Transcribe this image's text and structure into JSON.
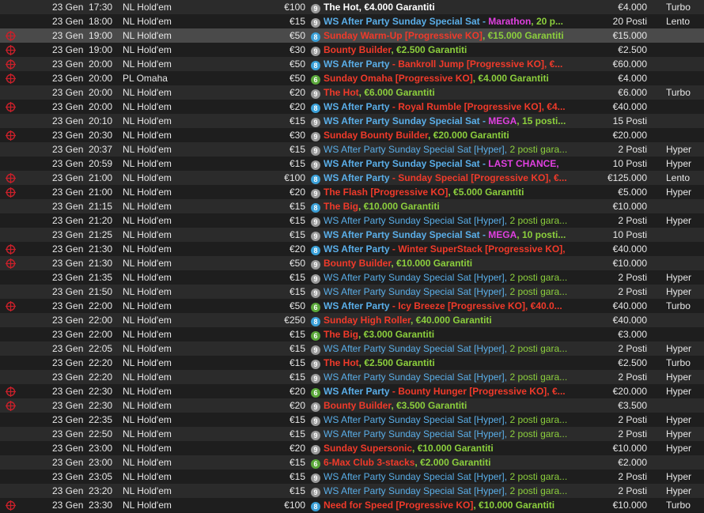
{
  "colors": {
    "white": "#ffffff",
    "red": "#f03a2a",
    "green": "#8ccf3d",
    "blue": "#5aaee8",
    "magenta": "#e040e0",
    "badge_gray": "#9a9a9a",
    "badge_blue": "#3aa0d8",
    "badge_green": "#5aa83a",
    "pk_icon": "#c8202a"
  },
  "rows": [
    {
      "pk": false,
      "date": "23 Gen",
      "time": "17:30",
      "game": "NL Hold'em",
      "buyin": "€100",
      "badge": "9",
      "badge_color": "badge_gray",
      "name": [
        {
          "t": "The Hot, €4.000 Garantiti",
          "c": "white"
        }
      ],
      "prize": "€4.000",
      "speed": "Turbo"
    },
    {
      "pk": false,
      "date": "23 Gen",
      "time": "18:00",
      "game": "NL Hold'em",
      "buyin": "€15",
      "badge": "9",
      "badge_color": "badge_gray",
      "name": [
        {
          "t": "WS After Party Sunday Special Sat - ",
          "c": "blue"
        },
        {
          "t": "Marathon",
          "c": "magenta"
        },
        {
          "t": ", 20 p...",
          "c": "green"
        }
      ],
      "prize": "20 Posti",
      "speed": "Lento"
    },
    {
      "pk": true,
      "sel": true,
      "date": "23 Gen",
      "time": "19:00",
      "game": "NL Hold'em",
      "buyin": "€50",
      "badge": "8",
      "badge_color": "badge_blue",
      "name": [
        {
          "t": "Sunday Warm-Up [Progressive KO]",
          "c": "red"
        },
        {
          "t": ", €15.000 Garantiti",
          "c": "green"
        }
      ],
      "prize": "€15.000",
      "speed": ""
    },
    {
      "pk": true,
      "date": "23 Gen",
      "time": "19:00",
      "game": "NL Hold'em",
      "buyin": "€30",
      "badge": "9",
      "badge_color": "badge_gray",
      "name": [
        {
          "t": "Bounty Builder",
          "c": "red"
        },
        {
          "t": ", €2.500 Garantiti",
          "c": "green"
        }
      ],
      "prize": "€2.500",
      "speed": ""
    },
    {
      "pk": true,
      "date": "23 Gen",
      "time": "20:00",
      "game": "NL Hold'em",
      "buyin": "€50",
      "badge": "8",
      "badge_color": "badge_blue",
      "name": [
        {
          "t": "WS After Party",
          "c": "blue"
        },
        {
          "t": " - Bankroll Jump [Progressive KO], €...",
          "c": "red"
        }
      ],
      "prize": "€60.000",
      "speed": ""
    },
    {
      "pk": true,
      "date": "23 Gen",
      "time": "20:00",
      "game": "PL Omaha",
      "buyin": "€50",
      "badge": "6",
      "badge_color": "badge_green",
      "name": [
        {
          "t": "Sunday Omaha [Progressive KO]",
          "c": "red"
        },
        {
          "t": ", €4.000 Garantiti",
          "c": "green"
        }
      ],
      "prize": "€4.000",
      "speed": ""
    },
    {
      "pk": false,
      "date": "23 Gen",
      "time": "20:00",
      "game": "NL Hold'em",
      "buyin": "€20",
      "badge": "9",
      "badge_color": "badge_gray",
      "name": [
        {
          "t": "The Hot",
          "c": "red"
        },
        {
          "t": ", €6.000 Garantiti",
          "c": "green"
        }
      ],
      "prize": "€6.000",
      "speed": "Turbo"
    },
    {
      "pk": true,
      "date": "23 Gen",
      "time": "20:00",
      "game": "NL Hold'em",
      "buyin": "€20",
      "badge": "8",
      "badge_color": "badge_blue",
      "name": [
        {
          "t": "WS After Party",
          "c": "blue"
        },
        {
          "t": " - Royal Rumble [Progressive KO], €4...",
          "c": "red"
        }
      ],
      "prize": "€40.000",
      "speed": ""
    },
    {
      "pk": false,
      "date": "23 Gen",
      "time": "20:10",
      "game": "NL Hold'em",
      "buyin": "€15",
      "badge": "9",
      "badge_color": "badge_gray",
      "name": [
        {
          "t": "WS After Party Sunday Special Sat - ",
          "c": "blue"
        },
        {
          "t": "MEGA",
          "c": "magenta"
        },
        {
          "t": ", 15 posti...",
          "c": "green"
        }
      ],
      "prize": "15 Posti",
      "speed": ""
    },
    {
      "pk": true,
      "date": "23 Gen",
      "time": "20:30",
      "game": "NL Hold'em",
      "buyin": "€30",
      "badge": "9",
      "badge_color": "badge_gray",
      "name": [
        {
          "t": "Sunday Bounty Builder",
          "c": "red"
        },
        {
          "t": ", €20.000 Garantiti",
          "c": "green"
        }
      ],
      "prize": "€20.000",
      "speed": ""
    },
    {
      "pk": false,
      "date": "23 Gen",
      "time": "20:37",
      "game": "NL Hold'em",
      "buyin": "€15",
      "badge": "9",
      "badge_color": "badge_gray",
      "name": [
        {
          "t": "WS After Party Sunday Special Sat [Hyper], ",
          "c": "blue",
          "n": true
        },
        {
          "t": "2 posti gara...",
          "c": "green",
          "n": true
        }
      ],
      "prize": "2 Posti",
      "speed": "Hyper"
    },
    {
      "pk": false,
      "date": "23 Gen",
      "time": "20:59",
      "game": "NL Hold'em",
      "buyin": "€15",
      "badge": "9",
      "badge_color": "badge_gray",
      "name": [
        {
          "t": "WS After Party Sunday Special Sat - ",
          "c": "blue"
        },
        {
          "t": "LAST CHANCE,",
          "c": "magenta"
        }
      ],
      "prize": "10 Posti",
      "speed": "Hyper"
    },
    {
      "pk": true,
      "date": "23 Gen",
      "time": "21:00",
      "game": "NL Hold'em",
      "buyin": "€100",
      "badge": "8",
      "badge_color": "badge_blue",
      "name": [
        {
          "t": "WS After Party",
          "c": "blue"
        },
        {
          "t": " - Sunday Special [Progressive KO], €...",
          "c": "red"
        }
      ],
      "prize": "€125.000",
      "speed": "Lento"
    },
    {
      "pk": true,
      "date": "23 Gen",
      "time": "21:00",
      "game": "NL Hold'em",
      "buyin": "€20",
      "badge": "9",
      "badge_color": "badge_gray",
      "name": [
        {
          "t": "The Flash [Progressive KO]",
          "c": "red"
        },
        {
          "t": ", €5.000 Garantiti",
          "c": "green"
        }
      ],
      "prize": "€5.000",
      "speed": "Hyper"
    },
    {
      "pk": false,
      "date": "23 Gen",
      "time": "21:15",
      "game": "NL Hold'em",
      "buyin": "€15",
      "badge": "8",
      "badge_color": "badge_blue",
      "name": [
        {
          "t": "The Big",
          "c": "red"
        },
        {
          "t": ", €10.000 Garantiti",
          "c": "green"
        }
      ],
      "prize": "€10.000",
      "speed": ""
    },
    {
      "pk": false,
      "date": "23 Gen",
      "time": "21:20",
      "game": "NL Hold'em",
      "buyin": "€15",
      "badge": "9",
      "badge_color": "badge_gray",
      "name": [
        {
          "t": "WS After Party Sunday Special Sat [Hyper], ",
          "c": "blue",
          "n": true
        },
        {
          "t": "2 posti gara...",
          "c": "green",
          "n": true
        }
      ],
      "prize": "2 Posti",
      "speed": "Hyper"
    },
    {
      "pk": false,
      "date": "23 Gen",
      "time": "21:25",
      "game": "NL Hold'em",
      "buyin": "€15",
      "badge": "9",
      "badge_color": "badge_gray",
      "name": [
        {
          "t": "WS After Party Sunday Special Sat - ",
          "c": "blue"
        },
        {
          "t": "MEGA",
          "c": "magenta"
        },
        {
          "t": ", 10 posti...",
          "c": "green"
        }
      ],
      "prize": "10 Posti",
      "speed": ""
    },
    {
      "pk": true,
      "date": "23 Gen",
      "time": "21:30",
      "game": "NL Hold'em",
      "buyin": "€20",
      "badge": "8",
      "badge_color": "badge_blue",
      "name": [
        {
          "t": "WS After Party",
          "c": "blue"
        },
        {
          "t": " - Winter SuperStack [Progressive KO],",
          "c": "red"
        }
      ],
      "prize": "€40.000",
      "speed": ""
    },
    {
      "pk": true,
      "date": "23 Gen",
      "time": "21:30",
      "game": "NL Hold'em",
      "buyin": "€50",
      "badge": "9",
      "badge_color": "badge_gray",
      "name": [
        {
          "t": "Bounty Builder",
          "c": "red"
        },
        {
          "t": ", €10.000 Garantiti",
          "c": "green"
        }
      ],
      "prize": "€10.000",
      "speed": ""
    },
    {
      "pk": false,
      "date": "23 Gen",
      "time": "21:35",
      "game": "NL Hold'em",
      "buyin": "€15",
      "badge": "9",
      "badge_color": "badge_gray",
      "name": [
        {
          "t": "WS After Party Sunday Special Sat [Hyper], ",
          "c": "blue",
          "n": true
        },
        {
          "t": "2 posti gara...",
          "c": "green",
          "n": true
        }
      ],
      "prize": "2 Posti",
      "speed": "Hyper"
    },
    {
      "pk": false,
      "date": "23 Gen",
      "time": "21:50",
      "game": "NL Hold'em",
      "buyin": "€15",
      "badge": "9",
      "badge_color": "badge_gray",
      "name": [
        {
          "t": "WS After Party Sunday Special Sat [Hyper], ",
          "c": "blue",
          "n": true
        },
        {
          "t": "2 posti gara...",
          "c": "green",
          "n": true
        }
      ],
      "prize": "2 Posti",
      "speed": "Hyper"
    },
    {
      "pk": true,
      "date": "23 Gen",
      "time": "22:00",
      "game": "NL Hold'em",
      "buyin": "€50",
      "badge": "6",
      "badge_color": "badge_green",
      "name": [
        {
          "t": "WS After Party",
          "c": "blue"
        },
        {
          "t": " - Icy Breeze [Progressive KO], €40.0...",
          "c": "red"
        }
      ],
      "prize": "€40.000",
      "speed": "Turbo"
    },
    {
      "pk": false,
      "date": "23 Gen",
      "time": "22:00",
      "game": "NL Hold'em",
      "buyin": "€250",
      "badge": "8",
      "badge_color": "badge_blue",
      "name": [
        {
          "t": "Sunday High Roller",
          "c": "red"
        },
        {
          "t": ", €40.000 Garantiti",
          "c": "green"
        }
      ],
      "prize": "€40.000",
      "speed": ""
    },
    {
      "pk": false,
      "date": "23 Gen",
      "time": "22:00",
      "game": "NL Hold'em",
      "buyin": "€15",
      "badge": "6",
      "badge_color": "badge_green",
      "name": [
        {
          "t": "The Big",
          "c": "red"
        },
        {
          "t": ", €3.000 Garantiti",
          "c": "green"
        }
      ],
      "prize": "€3.000",
      "speed": ""
    },
    {
      "pk": false,
      "date": "23 Gen",
      "time": "22:05",
      "game": "NL Hold'em",
      "buyin": "€15",
      "badge": "9",
      "badge_color": "badge_gray",
      "name": [
        {
          "t": "WS After Party Sunday Special Sat [Hyper], ",
          "c": "blue",
          "n": true
        },
        {
          "t": "2 posti gara...",
          "c": "green",
          "n": true
        }
      ],
      "prize": "2 Posti",
      "speed": "Hyper"
    },
    {
      "pk": false,
      "date": "23 Gen",
      "time": "22:20",
      "game": "NL Hold'em",
      "buyin": "€15",
      "badge": "9",
      "badge_color": "badge_gray",
      "name": [
        {
          "t": "The Hot",
          "c": "red"
        },
        {
          "t": ", €2.500 Garantiti",
          "c": "green"
        }
      ],
      "prize": "€2.500",
      "speed": "Turbo"
    },
    {
      "pk": false,
      "date": "23 Gen",
      "time": "22:20",
      "game": "NL Hold'em",
      "buyin": "€15",
      "badge": "9",
      "badge_color": "badge_gray",
      "name": [
        {
          "t": "WS After Party Sunday Special Sat [Hyper], ",
          "c": "blue",
          "n": true
        },
        {
          "t": "2 posti gara...",
          "c": "green",
          "n": true
        }
      ],
      "prize": "2 Posti",
      "speed": "Hyper"
    },
    {
      "pk": true,
      "date": "23 Gen",
      "time": "22:30",
      "game": "NL Hold'em",
      "buyin": "€20",
      "badge": "6",
      "badge_color": "badge_green",
      "name": [
        {
          "t": "WS After Party",
          "c": "blue"
        },
        {
          "t": " - Bounty Hunger [Progressive KO], €...",
          "c": "red"
        }
      ],
      "prize": "€20.000",
      "speed": "Hyper"
    },
    {
      "pk": true,
      "date": "23 Gen",
      "time": "22:30",
      "game": "NL Hold'em",
      "buyin": "€20",
      "badge": "9",
      "badge_color": "badge_gray",
      "name": [
        {
          "t": "Bounty Builder",
          "c": "red"
        },
        {
          "t": ", €3.500 Garantiti",
          "c": "green"
        }
      ],
      "prize": "€3.500",
      "speed": ""
    },
    {
      "pk": false,
      "date": "23 Gen",
      "time": "22:35",
      "game": "NL Hold'em",
      "buyin": "€15",
      "badge": "9",
      "badge_color": "badge_gray",
      "name": [
        {
          "t": "WS After Party Sunday Special Sat [Hyper], ",
          "c": "blue",
          "n": true
        },
        {
          "t": "2 posti gara...",
          "c": "green",
          "n": true
        }
      ],
      "prize": "2 Posti",
      "speed": "Hyper"
    },
    {
      "pk": false,
      "date": "23 Gen",
      "time": "22:50",
      "game": "NL Hold'em",
      "buyin": "€15",
      "badge": "9",
      "badge_color": "badge_gray",
      "name": [
        {
          "t": "WS After Party Sunday Special Sat [Hyper], ",
          "c": "blue",
          "n": true
        },
        {
          "t": "2 posti gara...",
          "c": "green",
          "n": true
        }
      ],
      "prize": "2 Posti",
      "speed": "Hyper"
    },
    {
      "pk": false,
      "date": "23 Gen",
      "time": "23:00",
      "game": "NL Hold'em",
      "buyin": "€20",
      "badge": "9",
      "badge_color": "badge_gray",
      "name": [
        {
          "t": "Sunday Supersonic",
          "c": "red"
        },
        {
          "t": ", €10.000 Garantiti",
          "c": "green"
        }
      ],
      "prize": "€10.000",
      "speed": "Hyper"
    },
    {
      "pk": false,
      "date": "23 Gen",
      "time": "23:00",
      "game": "NL Hold'em",
      "buyin": "€15",
      "badge": "6",
      "badge_color": "badge_green",
      "name": [
        {
          "t": "6-Max Club 3-stacks",
          "c": "red"
        },
        {
          "t": ", €2.000 Garantiti",
          "c": "green"
        }
      ],
      "prize": "€2.000",
      "speed": ""
    },
    {
      "pk": false,
      "date": "23 Gen",
      "time": "23:05",
      "game": "NL Hold'em",
      "buyin": "€15",
      "badge": "9",
      "badge_color": "badge_gray",
      "name": [
        {
          "t": "WS After Party Sunday Special Sat [Hyper], ",
          "c": "blue",
          "n": true
        },
        {
          "t": "2 posti gara...",
          "c": "green",
          "n": true
        }
      ],
      "prize": "2 Posti",
      "speed": "Hyper"
    },
    {
      "pk": false,
      "date": "23 Gen",
      "time": "23:20",
      "game": "NL Hold'em",
      "buyin": "€15",
      "badge": "9",
      "badge_color": "badge_gray",
      "name": [
        {
          "t": "WS After Party Sunday Special Sat [Hyper], ",
          "c": "blue",
          "n": true
        },
        {
          "t": "2 posti gara...",
          "c": "green",
          "n": true
        }
      ],
      "prize": "2 Posti",
      "speed": "Hyper"
    },
    {
      "pk": true,
      "date": "23 Gen",
      "time": "23:30",
      "game": "NL Hold'em",
      "buyin": "€100",
      "badge": "8",
      "badge_color": "badge_blue",
      "name": [
        {
          "t": "Need for Speed [Progressive KO]",
          "c": "red"
        },
        {
          "t": ", €10.000 Garantiti",
          "c": "green"
        }
      ],
      "prize": "€10.000",
      "speed": "Turbo"
    }
  ]
}
